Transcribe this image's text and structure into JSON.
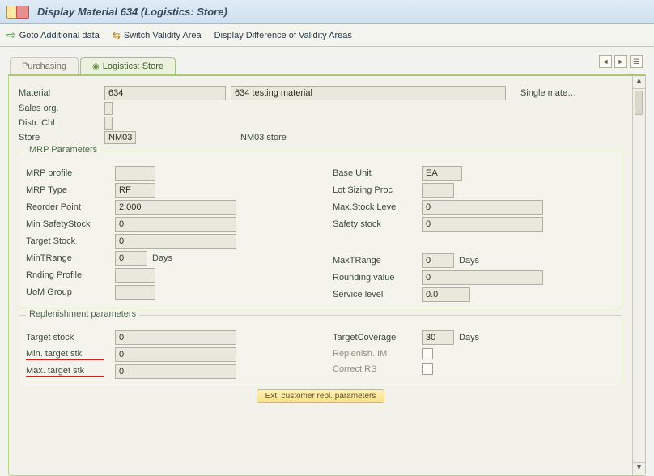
{
  "title": "Display Material 634 (Logistics: Store)",
  "toolbar": {
    "goto": "Goto Additional data",
    "switch": "Switch Validity Area",
    "diff": "Display Difference of Validity Areas"
  },
  "tabs": {
    "purchasing": "Purchasing",
    "logistics": "Logistics: Store"
  },
  "header": {
    "material_lbl": "Material",
    "material_no": "634",
    "material_desc": "634 testing material",
    "single": "Single mate…",
    "sales_org_lbl": "Sales org.",
    "sales_org_val": "",
    "distr_lbl": "Distr. Chl",
    "distr_val": "",
    "store_lbl": "Store",
    "store_code": "NM03",
    "store_name": "NM03 store"
  },
  "mrp": {
    "title": "MRP Parameters",
    "profile_lbl": "MRP profile",
    "profile_val": "",
    "type_lbl": "MRP Type",
    "type_val": "RF",
    "reorder_lbl": "Reorder Point",
    "reorder_val": "2,000",
    "minsafe_lbl": "Min SafetyStock",
    "minsafe_val": "0",
    "target_lbl": "Target Stock",
    "target_val": "0",
    "mintr_lbl": "MinTRange",
    "mintr_val": "0",
    "rnd_lbl": "Rnding Profile",
    "rnd_val": "",
    "uom_lbl": "UoM Group",
    "uom_val": "",
    "base_lbl": "Base Unit",
    "base_val": "EA",
    "lot_lbl": "Lot Sizing Proc",
    "lot_val": "",
    "maxstk_lbl": "Max.Stock Level",
    "maxstk_val": "0",
    "safety_lbl": "Safety stock",
    "safety_val": "0",
    "maxtr_lbl": "MaxTRange",
    "maxtr_val": "0",
    "rndval_lbl": "Rounding value",
    "rndval_val": "0",
    "servlvl_lbl": "Service level",
    "servlvl_val": "0.0",
    "days": "Days"
  },
  "repl": {
    "title": "Replenishment parameters",
    "tstock_lbl": "Target stock",
    "tstock_val": "0",
    "min_lbl": "Min. target stk",
    "min_val": "0",
    "max_lbl": "Max. target stk",
    "max_val": "0",
    "cov_lbl": "TargetCoverage",
    "cov_val": "30",
    "im_lbl": "Replenish. IM",
    "rs_lbl": "Correct RS",
    "days": "Days"
  },
  "footer_btn": "Ext. customer repl. parameters"
}
